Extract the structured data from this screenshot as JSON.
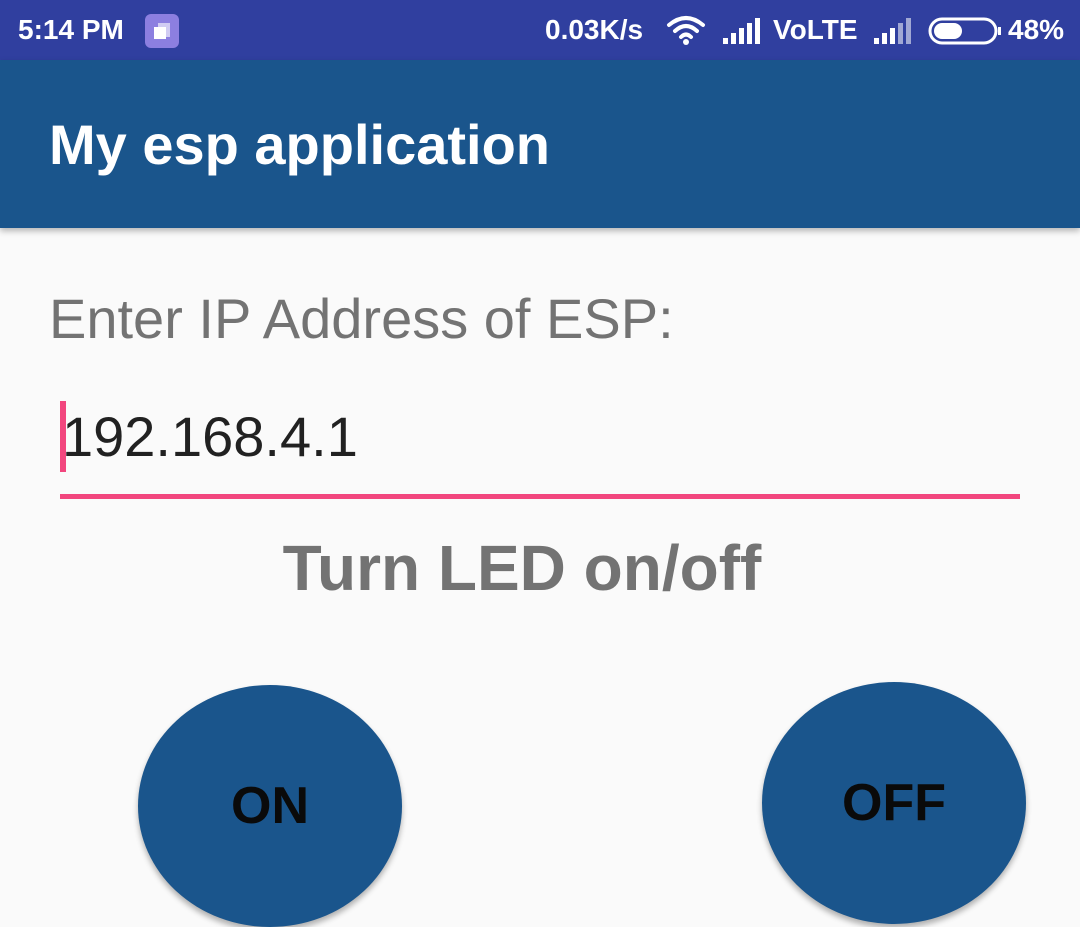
{
  "status_bar": {
    "time": "5:14 PM",
    "notification_icon": "app-notification-icon",
    "net_speed": "0.03K/s",
    "wifi_icon": "wifi-icon",
    "signal_icon": "cell-signal-icon",
    "network_label": "VoLTE",
    "battery_icon": "battery-icon",
    "battery_percent": "48%",
    "battery_level": 0.48
  },
  "app_bar": {
    "title": "My esp application"
  },
  "main": {
    "ip_label": "Enter IP Address of ESP:",
    "ip_value": "192.168.4.1",
    "led_heading": "Turn LED on/off",
    "on_label": "ON",
    "off_label": "OFF"
  },
  "colors": {
    "status_bar_bg": "#303f9f",
    "app_bar_bg": "#1a558c",
    "accent": "#f2467e",
    "button_bg": "#1a558c",
    "label_text": "#737373",
    "page_bg": "#fafafa"
  }
}
